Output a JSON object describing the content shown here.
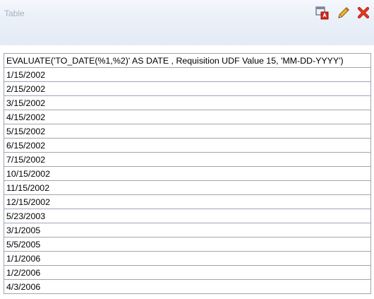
{
  "panel": {
    "title": "Table"
  },
  "toolbar": {
    "icons": [
      "export-icon",
      "edit-pencil-icon",
      "close-x-icon"
    ],
    "close_color": "#cc2200",
    "pencil_color": "#e0a020"
  },
  "table": {
    "column_header": "EVALUATE('TO_DATE(%1,%2)' AS DATE , Requisition UDF Value 15, 'MM-DD-YYYY')",
    "rows": [
      "1/15/2002",
      "2/15/2002",
      "3/15/2002",
      "4/15/2002",
      "5/15/2002",
      "6/15/2002",
      "7/15/2002",
      "10/15/2002",
      "11/15/2002",
      "12/15/2002",
      "5/23/2003",
      "3/1/2005",
      "5/5/2005",
      "1/1/2006",
      "1/2/2006",
      "4/3/2006"
    ]
  }
}
